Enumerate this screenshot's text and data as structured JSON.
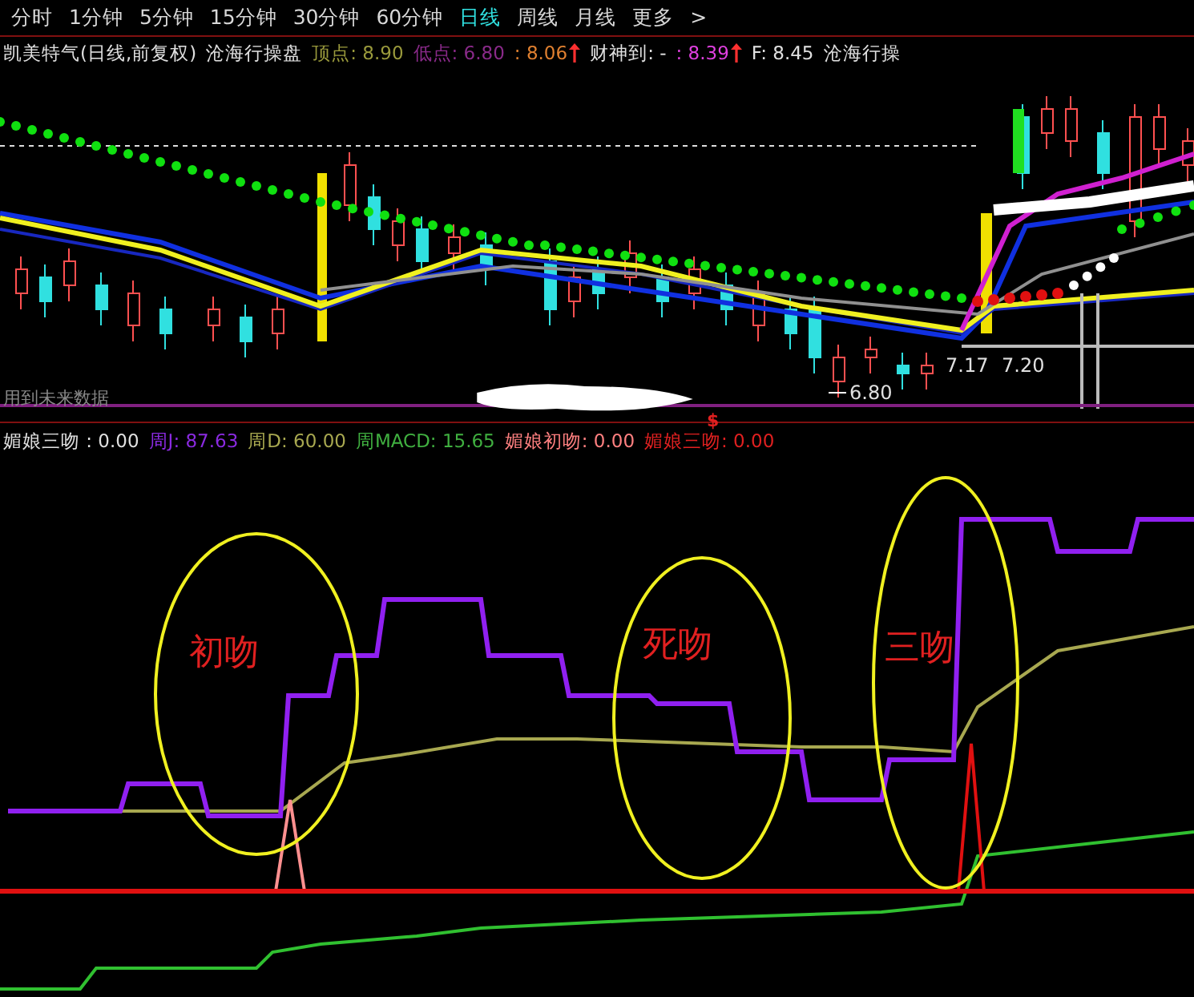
{
  "period_tabs": [
    {
      "label": "分时",
      "selected": false
    },
    {
      "label": "1分钟",
      "selected": false
    },
    {
      "label": "5分钟",
      "selected": false
    },
    {
      "label": "15分钟",
      "selected": false
    },
    {
      "label": "30分钟",
      "selected": false
    },
    {
      "label": "60分钟",
      "selected": false
    },
    {
      "label": "日线",
      "selected": true
    },
    {
      "label": "周线",
      "selected": false
    },
    {
      "label": "月线",
      "selected": false
    },
    {
      "label": "更多",
      "selected": false
    }
  ],
  "more_arrow": ">",
  "main_chart": {
    "title": "凯美特气(日线,前复权)",
    "indicator": "沧海行操盘",
    "readings": [
      {
        "text": "顶点: 8.90",
        "color": "#9a9a3c",
        "arrow": false
      },
      {
        "text": "低点: 6.80",
        "color": "#8a2a8a",
        "arrow": false
      },
      {
        "text": ": 8.06",
        "color": "#e08030",
        "arrow": true
      },
      {
        "text": "财神到: -",
        "color": "#e0e0e0",
        "arrow": false
      },
      {
        "text": ": 8.39",
        "color": "#e040e0",
        "arrow": true
      },
      {
        "text": "F: 8.45",
        "color": "#e0e0e0",
        "arrow": false
      },
      {
        "text": "沧海行操",
        "color": "#e0e0e0",
        "arrow": false
      }
    ],
    "price_labels": [
      {
        "text": "7.17",
        "kind": "low"
      },
      {
        "text": "7.20",
        "kind": "buy"
      },
      {
        "text": "6.80",
        "kind": "bottom"
      }
    ],
    "future_data_note": "用到未来数据",
    "signal_mark": "$"
  },
  "indicator_panel": {
    "readings": [
      {
        "text": "媚娘三吻 : 0.00",
        "color": "#e0e0e0"
      },
      {
        "text": "周J: 87.63",
        "color": "#8a2ae0"
      },
      {
        "text": "周D: 60.00",
        "color": "#a8a850"
      },
      {
        "text": "周MACD: 15.65",
        "color": "#40b040"
      },
      {
        "text": "媚娘初吻: 0.00",
        "color": "#ff8080"
      },
      {
        "text": "媚娘三吻: 0.00",
        "color": "#e02020"
      }
    ],
    "annotations": [
      {
        "text": "初吻"
      },
      {
        "text": "死吻"
      },
      {
        "text": "三吻"
      }
    ]
  }
}
